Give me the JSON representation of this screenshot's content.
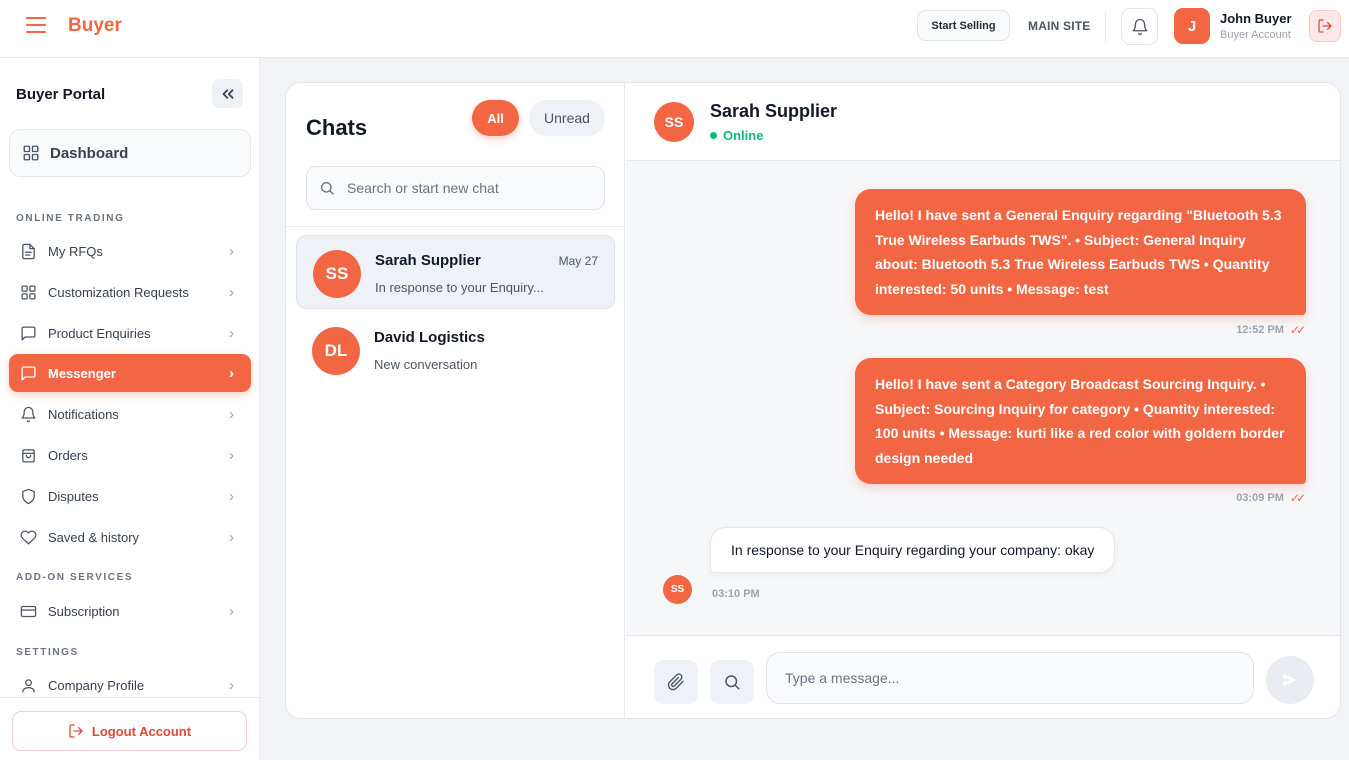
{
  "header": {
    "brand": "Buyer",
    "start_selling": "Start Selling",
    "main_site": "MAIN SITE",
    "user_initial": "J",
    "user_name": "John Buyer",
    "user_role": "Buyer Account"
  },
  "sidebar": {
    "title": "Buyer Portal",
    "dashboard": "Dashboard",
    "sections": {
      "online_trading": "ONLINE TRADING",
      "add_on": "ADD-ON SERVICES",
      "settings": "SETTINGS"
    },
    "items": [
      {
        "label": "My RFQs",
        "icon": "document-icon"
      },
      {
        "label": "Customization Requests",
        "icon": "grid-icon"
      },
      {
        "label": "Product Enquiries",
        "icon": "chat-icon"
      },
      {
        "label": "Messenger",
        "icon": "chat-icon",
        "active": true
      },
      {
        "label": "Notifications",
        "icon": "bell-icon"
      },
      {
        "label": "Orders",
        "icon": "bag-icon"
      },
      {
        "label": "Disputes",
        "icon": "shield-icon"
      },
      {
        "label": "Saved & history",
        "icon": "heart-icon"
      },
      {
        "label": "Subscription",
        "icon": "card-icon"
      },
      {
        "label": "Company Profile",
        "icon": "user-icon"
      }
    ],
    "logout": "Logout Account"
  },
  "chats": {
    "title": "Chats",
    "tab_all": "All",
    "tab_unread": "Unread",
    "search_placeholder": "Search or start new chat",
    "list": [
      {
        "initials": "SS",
        "name": "Sarah Supplier",
        "date": "May 27",
        "preview": "In response to your Enquiry..."
      },
      {
        "initials": "DL",
        "name": "David Logistics",
        "date": "",
        "preview": "New conversation"
      }
    ]
  },
  "conversation": {
    "initials": "SS",
    "name": "Sarah Supplier",
    "status": "Online",
    "messages": [
      {
        "text": "Hello! I have sent a General Enquiry regarding \"Bluetooth 5.3 True Wireless Earbuds TWS\". • Subject: General Inquiry about: Bluetooth 5.3 True Wireless Earbuds TWS • Quantity interested: 50 units • Message: test",
        "time": "12:52 PM"
      },
      {
        "text": "Hello! I have sent a Category Broadcast Sourcing Inquiry. • Subject: Sourcing Inquiry for category • Quantity interested: 100 units • Message: kurti like a red color with goldern border design needed",
        "time": "03:09 PM"
      },
      {
        "text": "In response to your Enquiry regarding your company: okay",
        "time": "03:10 PM",
        "sender_initials": "SS"
      }
    ],
    "input_placeholder": "Type a message..."
  },
  "colors": {
    "accent": "#f26644",
    "online": "#10b981"
  }
}
